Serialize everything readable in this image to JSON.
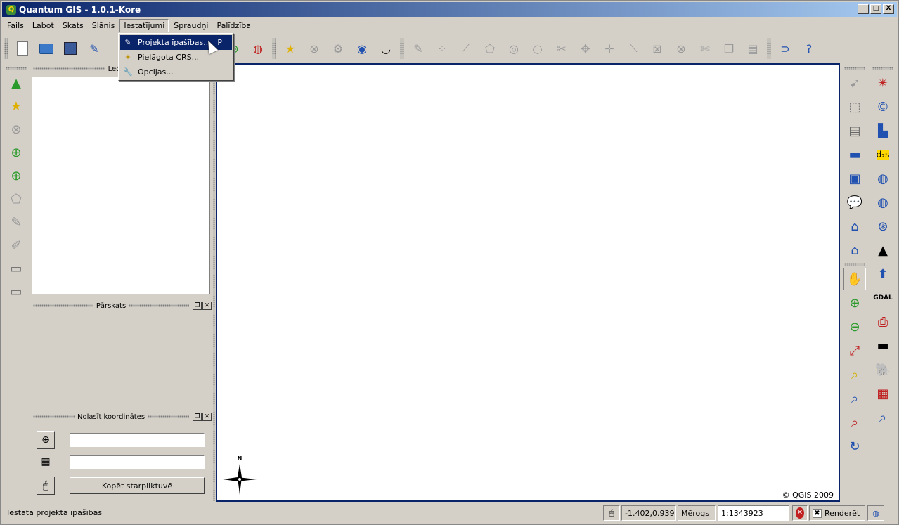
{
  "window": {
    "title": "Quantum GIS - 1.0.1-Kore",
    "app_icon": "qgis-q-icon"
  },
  "window_buttons": {
    "minimize": "_",
    "maximize": "□",
    "close": "X"
  },
  "menubar": {
    "items": [
      "Fails",
      "Labot",
      "Skats",
      "Slānis",
      "Iestatījumi",
      "Spraudņi",
      "Palīdzība"
    ],
    "active": "Iestatījumi"
  },
  "dropdown": {
    "items": [
      {
        "label": "Projekta īpašības...",
        "shortcut": "P",
        "icon": "project-properties-icon",
        "selected": true
      },
      {
        "label": "Pielāgota CRS...",
        "shortcut": "",
        "icon": "custom-crs-icon",
        "selected": false
      },
      {
        "label": "Opcijas...",
        "shortcut": "",
        "icon": "options-wrench-icon",
        "selected": false
      }
    ]
  },
  "panels": {
    "legend": {
      "title": "Leģend"
    },
    "overview": {
      "title": "Pārskats"
    },
    "coordinates": {
      "title": "Nolasīt koordinātes",
      "input1": "",
      "input2": "",
      "copy_button": "Kopēt starpliktuvē"
    }
  },
  "canvas": {
    "copyright": "© QGIS 2009",
    "north_label": "N"
  },
  "statusbar": {
    "message": "Iestata projekta īpašības",
    "coordinates": "-1.402,0.939",
    "scale_label": "Mērogs",
    "scale_value": "1:1343923",
    "render_label": "Renderēt",
    "render_checked": true
  },
  "colors": {
    "title_start": "#0a246a",
    "title_end": "#a6caf0",
    "selection": "#0a246a",
    "canvas_border": "#0a246a"
  }
}
